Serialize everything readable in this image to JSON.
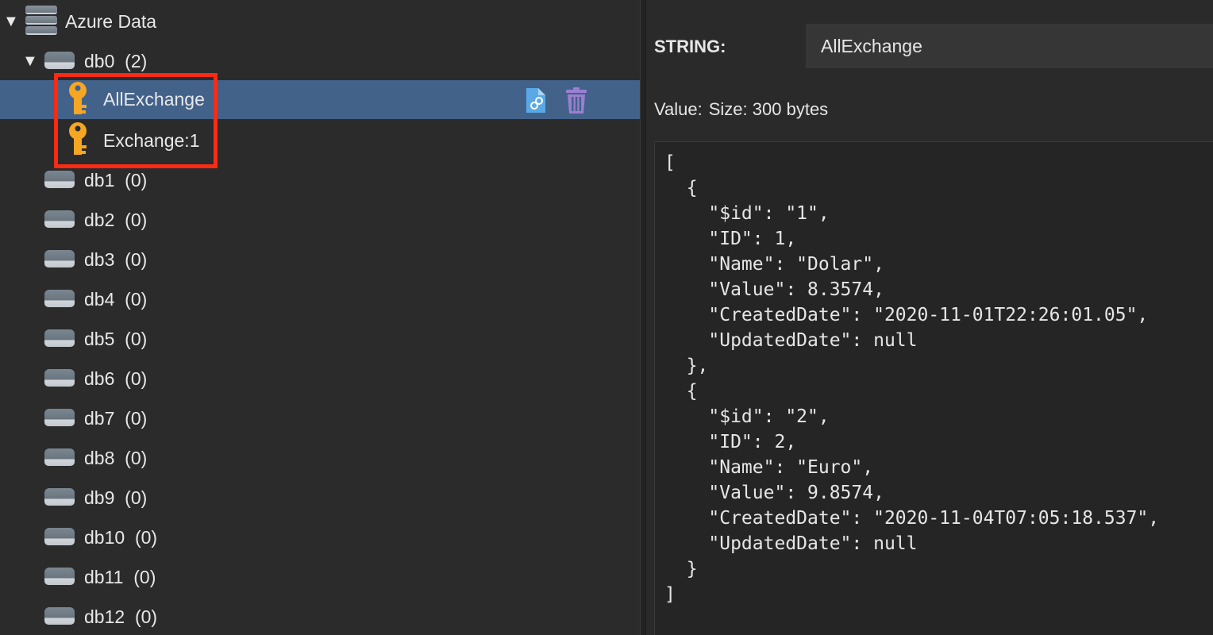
{
  "tree": {
    "server": {
      "name": "Azure Data",
      "icon": "server-stack-icon"
    },
    "db0": {
      "name": "db0",
      "count": "(2)",
      "icon": "database-icon"
    },
    "keys": [
      {
        "name": "AllExchange",
        "icon": "key-icon",
        "selected": true
      },
      {
        "name": "Exchange:1",
        "icon": "key-icon",
        "selected": false
      }
    ],
    "databases": [
      {
        "name": "db1",
        "count": "(0)"
      },
      {
        "name": "db2",
        "count": "(0)"
      },
      {
        "name": "db3",
        "count": "(0)"
      },
      {
        "name": "db4",
        "count": "(0)"
      },
      {
        "name": "db5",
        "count": "(0)"
      },
      {
        "name": "db6",
        "count": "(0)"
      },
      {
        "name": "db7",
        "count": "(0)"
      },
      {
        "name": "db8",
        "count": "(0)"
      },
      {
        "name": "db9",
        "count": "(0)"
      },
      {
        "name": "db10",
        "count": "(0)"
      },
      {
        "name": "db11",
        "count": "(0)"
      },
      {
        "name": "db12",
        "count": "(0)"
      }
    ],
    "row_actions": [
      "copy-link-icon",
      "trash-icon"
    ],
    "highlight_color": "#ff2a12",
    "selection_color": "#42628a"
  },
  "detail": {
    "type_label": "STRING:",
    "key_name": "AllExchange",
    "value_label": "Value:",
    "value_size": "Size: 300 bytes",
    "value_text": "[\n  {\n    \"$id\": \"1\",\n    \"ID\": 1,\n    \"Name\": \"Dolar\",\n    \"Value\": 8.3574,\n    \"CreatedDate\": \"2020-11-01T22:26:01.05\",\n    \"UpdatedDate\": null\n  },\n  {\n    \"$id\": \"2\",\n    \"ID\": 2,\n    \"Name\": \"Euro\",\n    \"Value\": 9.8574,\n    \"CreatedDate\": \"2020-11-04T07:05:18.537\",\n    \"UpdatedDate\": null\n  }\n]"
  }
}
